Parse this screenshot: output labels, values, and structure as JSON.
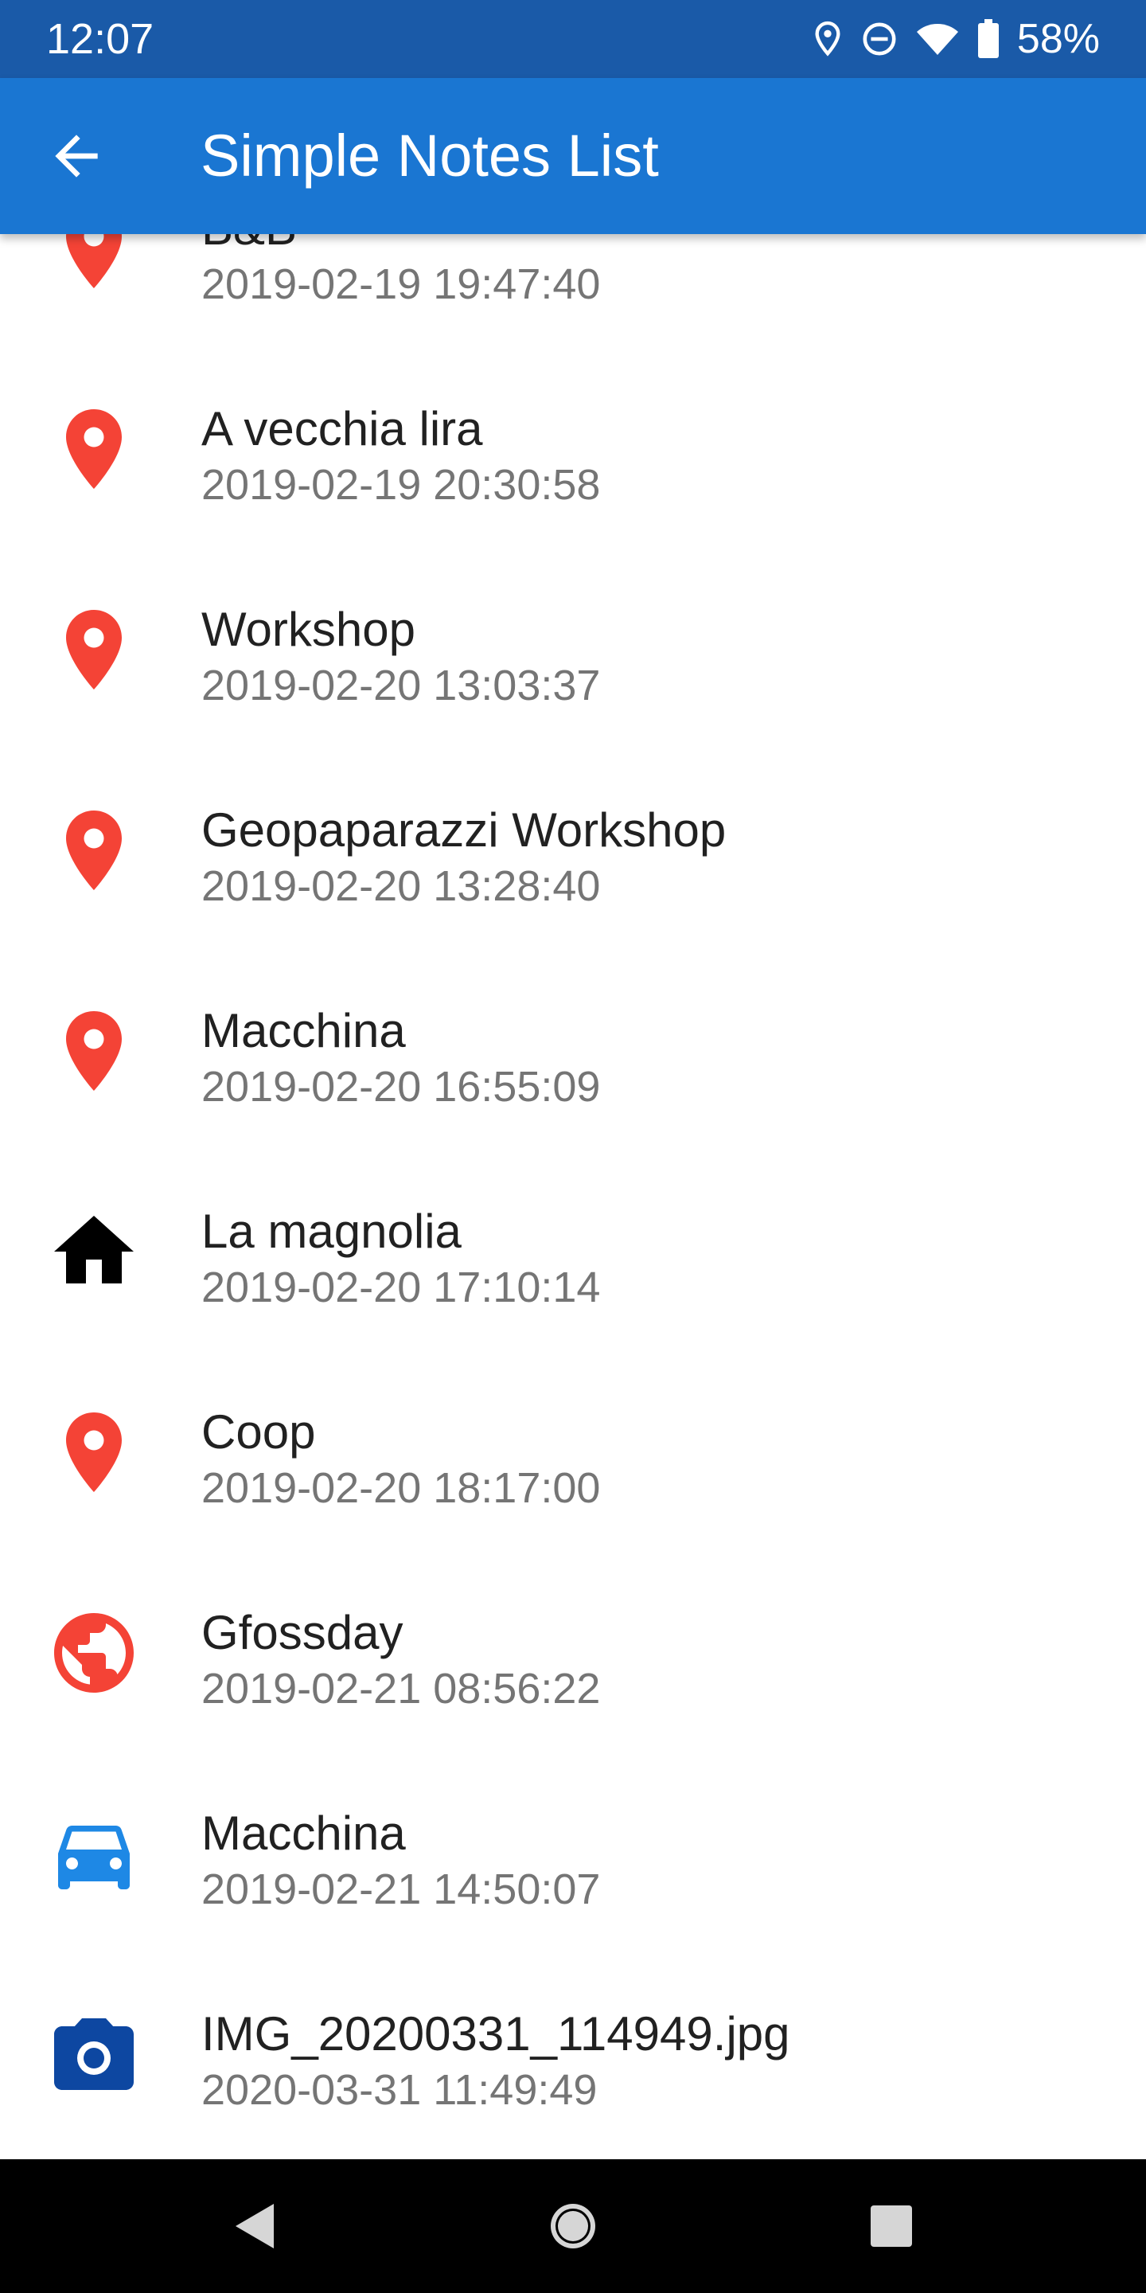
{
  "status_bar": {
    "time": "12:07",
    "battery_percent": "58%",
    "icons": [
      "location-icon",
      "do-not-disturb-icon",
      "wifi-icon",
      "battery-icon"
    ]
  },
  "app_bar": {
    "title": "Simple Notes List",
    "back_icon": "arrow-back-icon"
  },
  "colors": {
    "status_bar": "#1a5aa8",
    "app_bar": "#1a76d2",
    "marker_red": "#f44336",
    "car_blue": "#1e88e5",
    "camera_blue": "#0d47a1"
  },
  "notes": [
    {
      "name": "B&B",
      "date": "2019-02-19 19:47:40",
      "icon": "map-marker-icon"
    },
    {
      "name": "A vecchia lira",
      "date": "2019-02-19 20:30:58",
      "icon": "map-marker-icon"
    },
    {
      "name": "Workshop",
      "date": "2019-02-20 13:03:37",
      "icon": "map-marker-icon"
    },
    {
      "name": "Geopaparazzi Workshop",
      "date": "2019-02-20 13:28:40",
      "icon": "map-marker-icon"
    },
    {
      "name": "Macchina",
      "date": "2019-02-20 16:55:09",
      "icon": "map-marker-icon"
    },
    {
      "name": "La magnolia",
      "date": "2019-02-20 17:10:14",
      "icon": "home-icon"
    },
    {
      "name": "Coop",
      "date": "2019-02-20 18:17:00",
      "icon": "map-marker-icon"
    },
    {
      "name": "Gfossday",
      "date": "2019-02-21 08:56:22",
      "icon": "globe-icon"
    },
    {
      "name": "Macchina",
      "date": "2019-02-21 14:50:07",
      "icon": "car-icon"
    },
    {
      "name": "IMG_20200331_114949.jpg",
      "date": "2020-03-31 11:49:49",
      "icon": "camera-icon"
    }
  ],
  "nav_bar": {
    "icons": [
      "nav-back-icon",
      "nav-home-icon",
      "nav-recents-icon"
    ]
  }
}
